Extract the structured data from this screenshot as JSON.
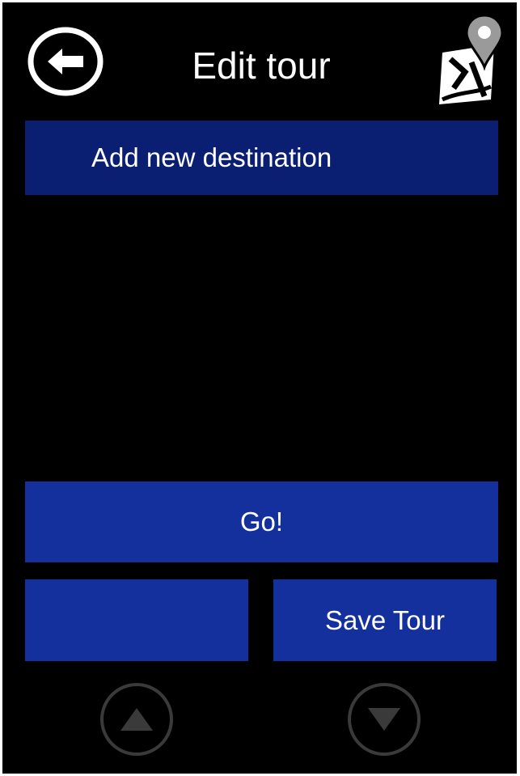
{
  "header": {
    "title": "Edit tour",
    "back_icon": "arrow-left-circle-icon",
    "map_icon": "map-pin-icon"
  },
  "actions": {
    "add_destination_label": "Add new destination",
    "go_label": "Go!",
    "blank_label": "",
    "save_label": "Save Tour"
  },
  "footer": {
    "up_icon": "triangle-up-icon",
    "down_icon": "triangle-down-icon"
  },
  "colors": {
    "background": "#000000",
    "add_button": "#0a1f72",
    "primary_button": "#13309d",
    "disabled_control": "#3a3a3a"
  }
}
